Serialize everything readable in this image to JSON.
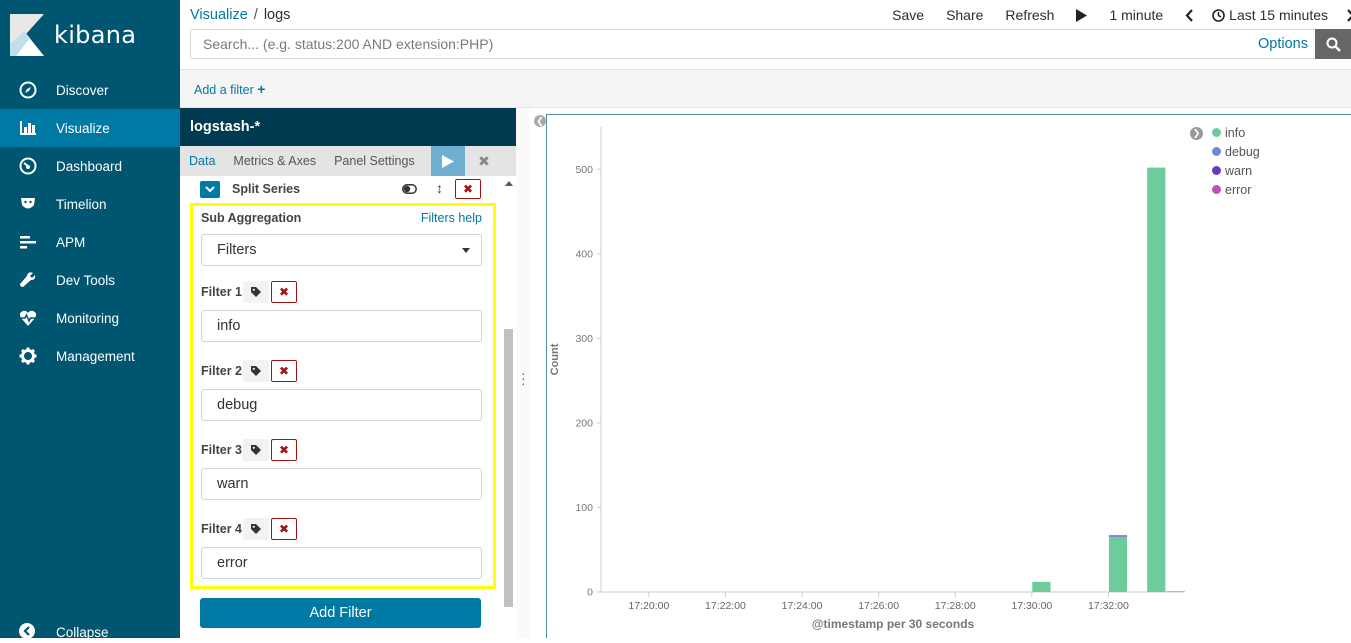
{
  "app": {
    "brand": "kibana"
  },
  "sidebar": {
    "items": [
      {
        "label": "Discover",
        "icon": "compass-icon"
      },
      {
        "label": "Visualize",
        "icon": "bar-chart-icon",
        "active": true
      },
      {
        "label": "Dashboard",
        "icon": "gauge-icon"
      },
      {
        "label": "Timelion",
        "icon": "timelion-icon"
      },
      {
        "label": "APM",
        "icon": "apm-icon"
      },
      {
        "label": "Dev Tools",
        "icon": "wrench-icon"
      },
      {
        "label": "Monitoring",
        "icon": "heartbeat-icon"
      },
      {
        "label": "Management",
        "icon": "gear-icon"
      }
    ],
    "collapse_label": "Collapse"
  },
  "breadcrumb": {
    "root": "Visualize",
    "separator": "/",
    "current": "logs"
  },
  "topmenu": {
    "save": "Save",
    "share": "Share",
    "refresh": "Refresh",
    "interval": "1 minute",
    "time_range": "Last 15 minutes"
  },
  "search": {
    "placeholder": "Search... (e.g. status:200 AND extension:PHP)",
    "value": "",
    "options_label": "Options"
  },
  "filterbar": {
    "add_filter": "Add a filter"
  },
  "editor": {
    "index_pattern": "logstash-*",
    "tabs": [
      "Data",
      "Metrics & Axes",
      "Panel Settings"
    ],
    "split_series_label": "Split Series",
    "sub_aggregation_label": "Sub Aggregation",
    "filters_help": "Filters help",
    "aggregation_value": "Filters",
    "filters": [
      {
        "label": "Filter 1",
        "value": "info"
      },
      {
        "label": "Filter 2",
        "value": "debug"
      },
      {
        "label": "Filter 3",
        "value": "warn"
      },
      {
        "label": "Filter 4",
        "value": "error"
      }
    ],
    "add_filter_button": "Add Filter"
  },
  "colors": {
    "sidebar": "#005571",
    "accent": "#0079a5",
    "highlight": "#ffff00"
  },
  "chart_data": {
    "type": "bar",
    "stacked": true,
    "xlabel": "@timestamp per 30 seconds",
    "ylabel": "Count",
    "ylim": [
      0,
      550
    ],
    "yticks": [
      0,
      100,
      200,
      300,
      400,
      500
    ],
    "xrange_minutes": [
      18.75,
      34.0
    ],
    "xticks": [
      "17:20:00",
      "17:22:00",
      "17:24:00",
      "17:26:00",
      "17:28:00",
      "17:30:00",
      "17:32:00"
    ],
    "xtick_minutes": [
      20,
      22,
      24,
      26,
      28,
      30,
      32
    ],
    "bar_width_minutes": 0.5,
    "grid": false,
    "legend_position": "top-right",
    "series": [
      {
        "name": "info",
        "color": "#6dcc9b",
        "points": [
          [
            30.0,
            12
          ],
          [
            32.0,
            65
          ],
          [
            33.0,
            502
          ],
          [
            33.5,
            1
          ]
        ]
      },
      {
        "name": "debug",
        "color": "#6f87d8",
        "points": [
          [
            32.0,
            1
          ]
        ]
      },
      {
        "name": "warn",
        "color": "#663db8",
        "points": [
          [
            32.0,
            1
          ]
        ]
      },
      {
        "name": "error",
        "color": "#bc52bc",
        "points": []
      }
    ]
  }
}
